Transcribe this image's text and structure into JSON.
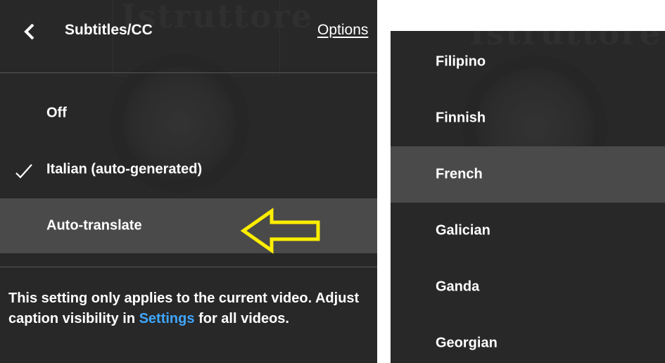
{
  "subtitles_menu": {
    "back_icon": "chevron-left-icon",
    "title": "Subtitles/CC",
    "options_label": "Options",
    "items": [
      {
        "label": "Off",
        "selected": false
      },
      {
        "label": "Italian (auto-generated)",
        "selected": true
      },
      {
        "label": "Auto-translate",
        "selected": false,
        "highlighted": true
      }
    ],
    "footer": {
      "text_before": "This setting only applies to the current video. Adjust caption visibility in",
      "link": "Settings",
      "text_after": "for all videos."
    },
    "annotation_color": "#ffee00"
  },
  "background_video": {
    "watermark": "Istruttore"
  },
  "language_list": {
    "items": [
      {
        "label": "Filipino"
      },
      {
        "label": "Finnish"
      },
      {
        "label": "French",
        "highlighted": true
      },
      {
        "label": "Galician"
      },
      {
        "label": "Ganda"
      },
      {
        "label": "Georgian"
      }
    ]
  },
  "colors": {
    "panel_bg": "#282828",
    "highlight_bg": "#4a4a4a",
    "link_blue": "#3ea6ff",
    "text": "#ffffff"
  }
}
